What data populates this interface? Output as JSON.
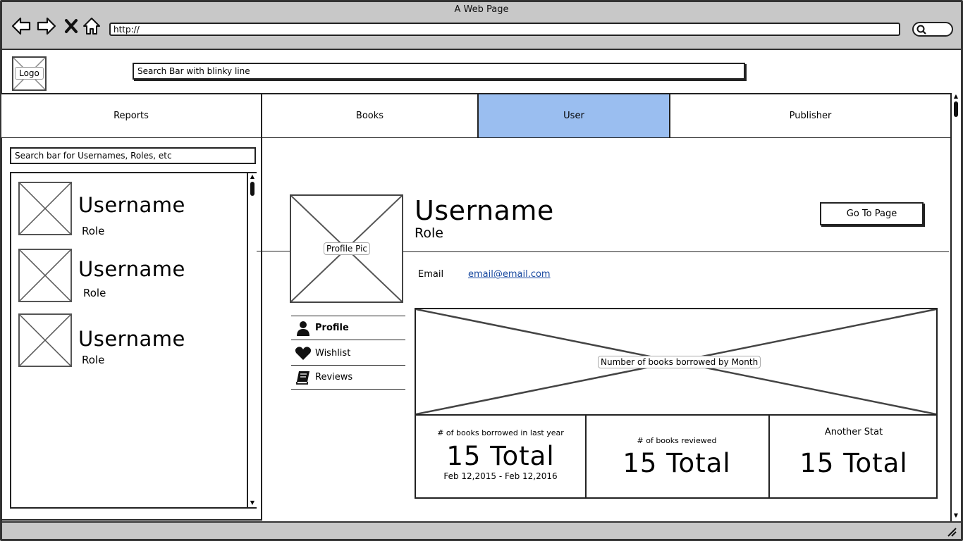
{
  "window": {
    "title": "A Web Page",
    "url": "http://"
  },
  "header": {
    "logo_label": "Logo",
    "search_placeholder": "Search Bar with blinky line"
  },
  "tabs": [
    {
      "label": "Reports",
      "active": false
    },
    {
      "label": "Books",
      "active": false
    },
    {
      "label": "User",
      "active": true
    },
    {
      "label": "Publisher",
      "active": false
    }
  ],
  "sidebar": {
    "search_placeholder": "Search bar for Usernames, Roles, etc",
    "users": [
      {
        "username": "Username",
        "role": "Role"
      },
      {
        "username": "Username",
        "role": "Role"
      },
      {
        "username": "Username",
        "role": "Role"
      }
    ]
  },
  "profile": {
    "pic_label": "Profile Pic",
    "username": "Username",
    "role": "Role",
    "goto_label": "Go To Page",
    "email_label": "Email",
    "email_value": "email@email.com"
  },
  "menu": [
    {
      "label": "Profile",
      "icon": "user-icon",
      "bold": true
    },
    {
      "label": "Wishlist",
      "icon": "heart-icon",
      "bold": false
    },
    {
      "label": "Reviews",
      "icon": "book-icon",
      "bold": false
    }
  ],
  "chart": {
    "label": "Number of books borrowed by Month"
  },
  "stats": [
    {
      "caption": "# of books borrowed in last year",
      "value": "15 Total",
      "sub": "Feb 12,2015 - Feb 12,2016"
    },
    {
      "caption": "# of books reviewed",
      "value": "15 Total",
      "sub": ""
    },
    {
      "caption": "Another Stat",
      "value": "15 Total",
      "sub": ""
    }
  ],
  "colors": {
    "active_tab": "#9abef0",
    "chrome": "#c8c8c8",
    "link": "#1a4aa0"
  }
}
